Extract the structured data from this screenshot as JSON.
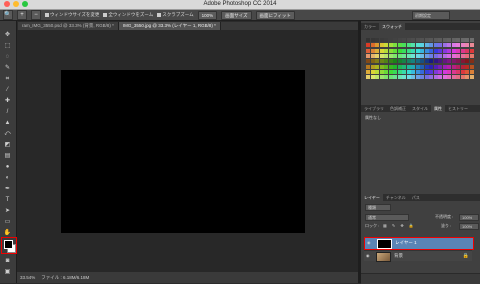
{
  "window": {
    "title": "Adobe Photoshop CC 2014"
  },
  "options_bar": {
    "resize_windows": "ウィンドウサイズを変更",
    "zoom_all": "全ウィンドウをズーム",
    "scrubby_zoom": "スクラブズーム",
    "zoom_percent": "100%",
    "fit_screen": "画面サイズ",
    "fill_screen": "画面にフィット",
    "workspace": "初期設定"
  },
  "tabs": [
    {
      "label": "ram_IMG_3550.psd @ 33.3% (背景, RGB/8) *"
    },
    {
      "label": "IMG_3550.jpg @ 33.3% (レイヤー 1, RGB/8) *"
    }
  ],
  "status": {
    "zoom": "33.54%",
    "file": "ファイル : 6.18M/6.18M"
  },
  "swatches_panel": {
    "tabs": [
      "カラー",
      "スウォッチ"
    ]
  },
  "adjust_panel": {
    "tabs": [
      "ライブラリ",
      "色調補正",
      "スタイル",
      "属性",
      "ヒストリー"
    ],
    "content": "属性なし"
  },
  "layers_panel": {
    "tabs": [
      "レイヤー",
      "チャンネル",
      "パス"
    ],
    "kind": "種類",
    "blend_mode": "通常",
    "opacity_label": "不透明度 :",
    "opacity": "100%",
    "lock_label": "ロック :",
    "fill_label": "塗り :",
    "fill": "100%",
    "layers": [
      {
        "name": "レイヤー 1",
        "selected": true
      },
      {
        "name": "背景",
        "selected": false
      }
    ]
  },
  "colors": {
    "accent": "#5b84b5",
    "highlight": "#e00000"
  }
}
